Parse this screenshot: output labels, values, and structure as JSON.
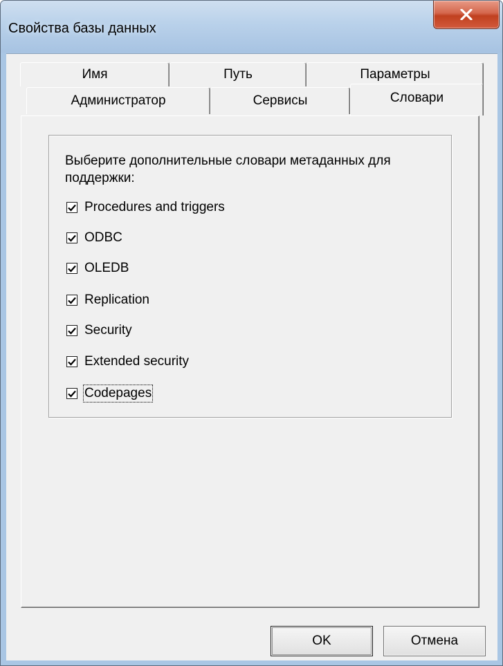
{
  "window": {
    "title": "Свойства базы данных",
    "close_glyph": "x"
  },
  "tabs": {
    "back_row": [
      {
        "label": "Имя"
      },
      {
        "label": "Путь"
      },
      {
        "label": "Параметры"
      }
    ],
    "front_row": [
      {
        "label": "Администратор"
      },
      {
        "label": "Сервисы"
      },
      {
        "label": "Словари",
        "active": true
      }
    ]
  },
  "panel": {
    "description": "Выберите дополнительные словари метаданных для поддержки:",
    "options": [
      {
        "label": "Procedures and triggers",
        "checked": true
      },
      {
        "label": "ODBC",
        "checked": true
      },
      {
        "label": "OLEDB",
        "checked": true
      },
      {
        "label": "Replication",
        "checked": true
      },
      {
        "label": "Security",
        "checked": true
      },
      {
        "label": "Extended security",
        "checked": true
      },
      {
        "label": "Codepages",
        "checked": true,
        "focused": true
      }
    ]
  },
  "buttons": {
    "ok": "OK",
    "cancel": "Отмена"
  },
  "colors": {
    "titlebar": "#b9d1ea",
    "close_button": "#c9533a",
    "dialog_face": "#f0f0f0"
  }
}
